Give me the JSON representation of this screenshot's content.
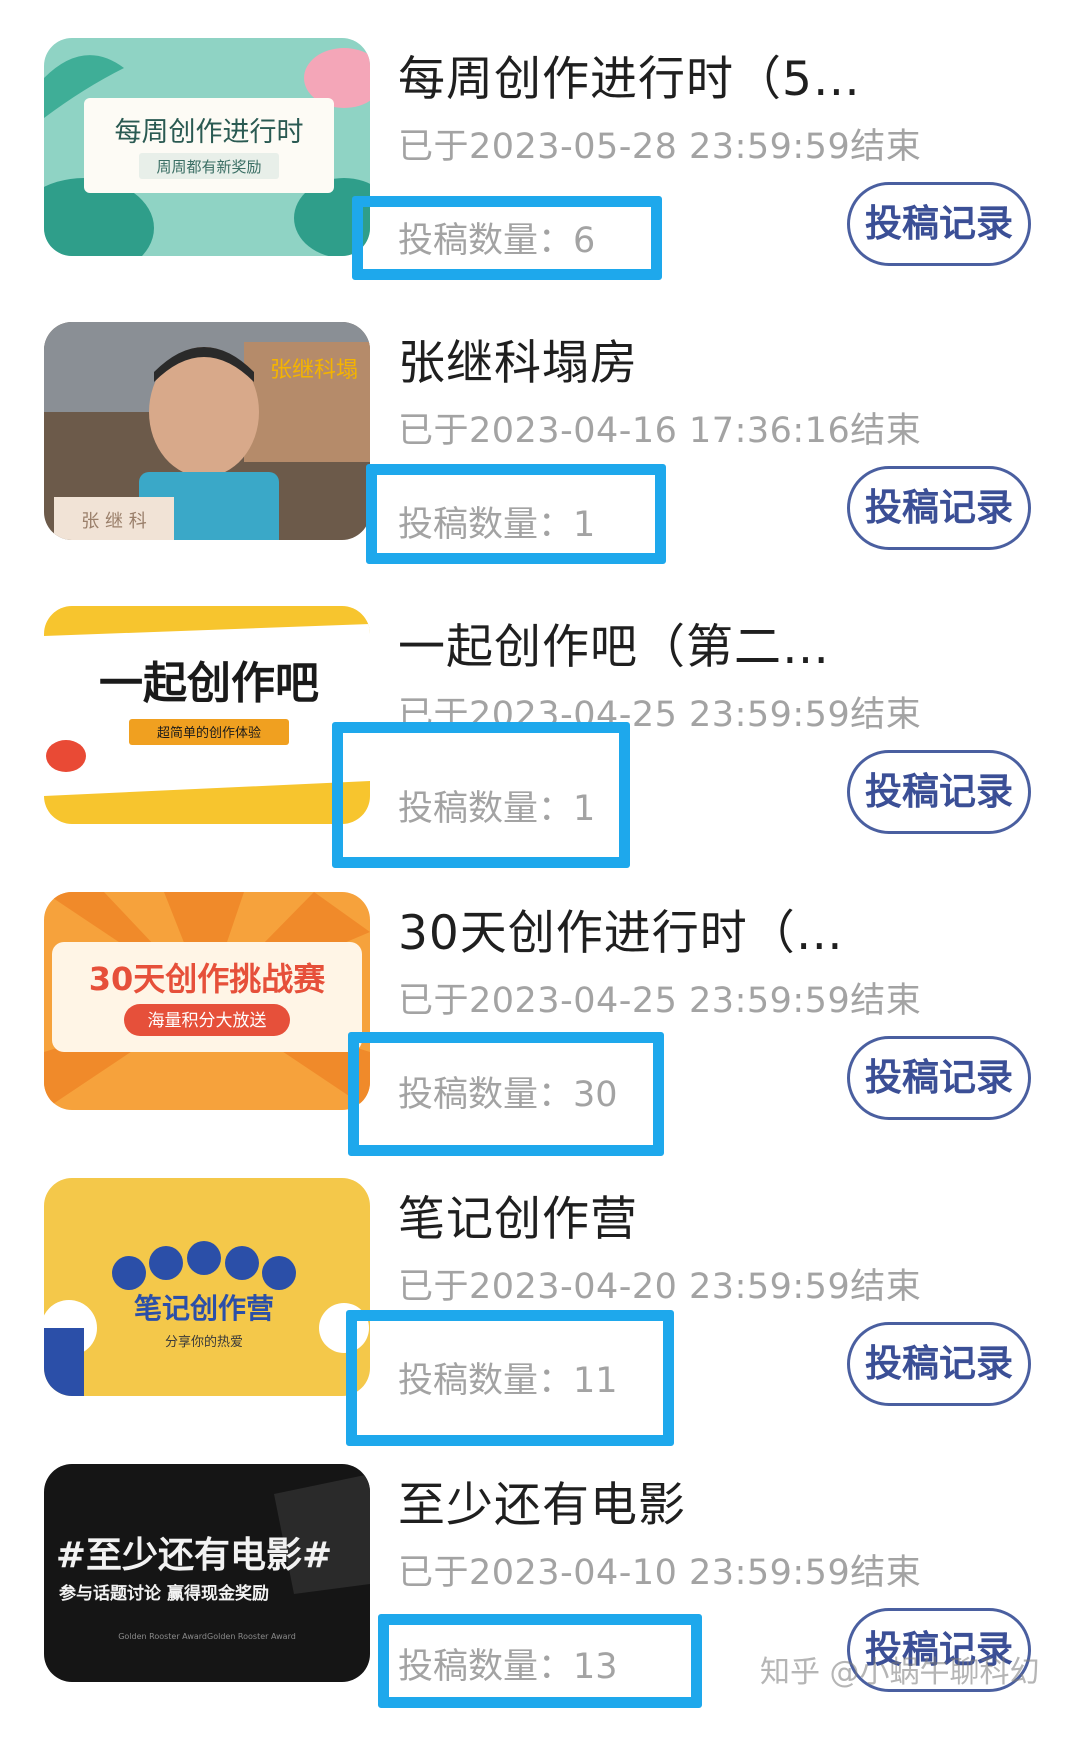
{
  "items": [
    {
      "title": "每周创作进行时（5…",
      "ended": "已于2023-05-28 23:59:59结束",
      "count": "投稿数量：6",
      "button": "投稿记录",
      "thumb": {
        "main": "每周创作进行时",
        "sub": "周周都有新奖励"
      }
    },
    {
      "title": "张继科塌房",
      "ended": "已于2023-04-16 17:36:16结束",
      "count": "投稿数量：1",
      "button": "投稿记录",
      "thumb": {
        "main": "张继科塌",
        "sub": "张 继 科"
      }
    },
    {
      "title": "一起创作吧（第二…",
      "ended": "已于2023-04-25 23:59:59结束",
      "count": "投稿数量：1",
      "button": "投稿记录",
      "thumb": {
        "main": "一起创作吧",
        "sub": "超简单的创作体验"
      }
    },
    {
      "title": "30天创作进行时（…",
      "ended": "已于2023-04-25 23:59:59结束",
      "count": "投稿数量：30",
      "button": "投稿记录",
      "thumb": {
        "main": "30天创作挑战赛",
        "sub": "海量积分大放送"
      }
    },
    {
      "title": "笔记创作营",
      "ended": "已于2023-04-20 23:59:59结束",
      "count": "投稿数量：11",
      "button": "投稿记录",
      "thumb": {
        "main": "笔记创作营",
        "sub": "分享你的热爱"
      }
    },
    {
      "title": "至少还有电影",
      "ended": "已于2023-04-10 23:59:59结束",
      "count": "投稿数量：13",
      "button": "投稿记录",
      "thumb": {
        "main": "#至少还有电影#",
        "sub": "参与话题讨论 赢得现金奖励",
        "tiny": "Golden Rooster AwardGolden Rooster Award"
      }
    }
  ],
  "watermark": "知乎 @小蜗牛聊科幻",
  "colors": {
    "highlight": "#1ea8ec",
    "button_border": "#4a5fa0",
    "meta_text": "#a3a3a3"
  }
}
